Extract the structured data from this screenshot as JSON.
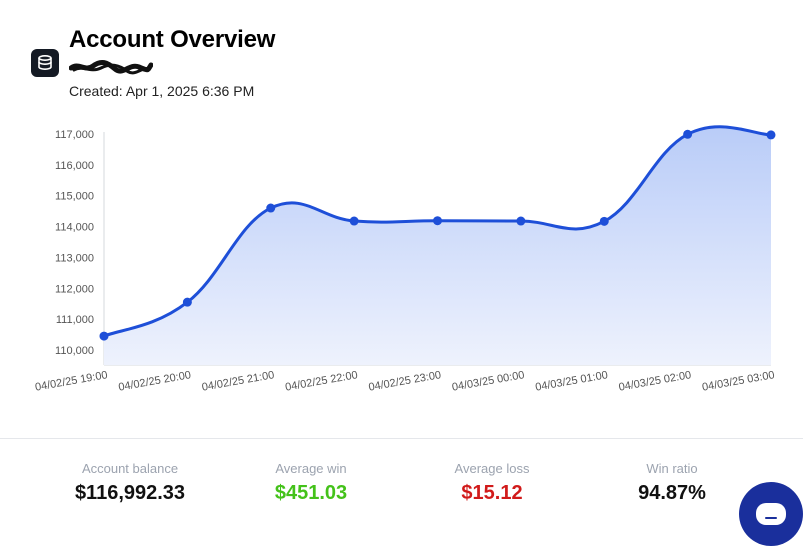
{
  "header": {
    "title": "Account Overview",
    "account_id_redacted": "redacted account number",
    "created": "Created: Apr 1, 2025 6:36 PM",
    "logo_icon": "database-icon"
  },
  "chart_data": {
    "type": "area",
    "title": "",
    "xlabel": "",
    "ylabel": "",
    "x": [
      "04/02/25 19:00",
      "04/02/25 20:00",
      "04/02/25 21:00",
      "04/02/25 22:00",
      "04/02/25 23:00",
      "04/03/25 00:00",
      "04/03/25 01:00",
      "04/03/25 02:00",
      "04/03/25 03:00"
    ],
    "values": [
      110450,
      111550,
      114600,
      114180,
      114190,
      114180,
      114170,
      116990,
      116970
    ],
    "yticks": [
      "110,000",
      "111,000",
      "112,000",
      "113,000",
      "114,000",
      "115,000",
      "116,000",
      "117,000"
    ],
    "ylim": [
      110000,
      117000
    ],
    "line_color": "#1e4fd8",
    "fill_top": "#b9ccf8",
    "fill_bottom": "#eef2fd",
    "grid": false
  },
  "stats": [
    {
      "label": "Account balance",
      "value": "$116,992.33",
      "color": "#111111"
    },
    {
      "label": "Average win",
      "value": "$451.03",
      "color": "#44c21a"
    },
    {
      "label": "Average loss",
      "value": "$15.12",
      "color": "#d11a1a"
    },
    {
      "label": "Win ratio",
      "value": "94.87%",
      "color": "#111111"
    }
  ],
  "chat_button": {
    "icon": "chat-bubble-icon"
  }
}
